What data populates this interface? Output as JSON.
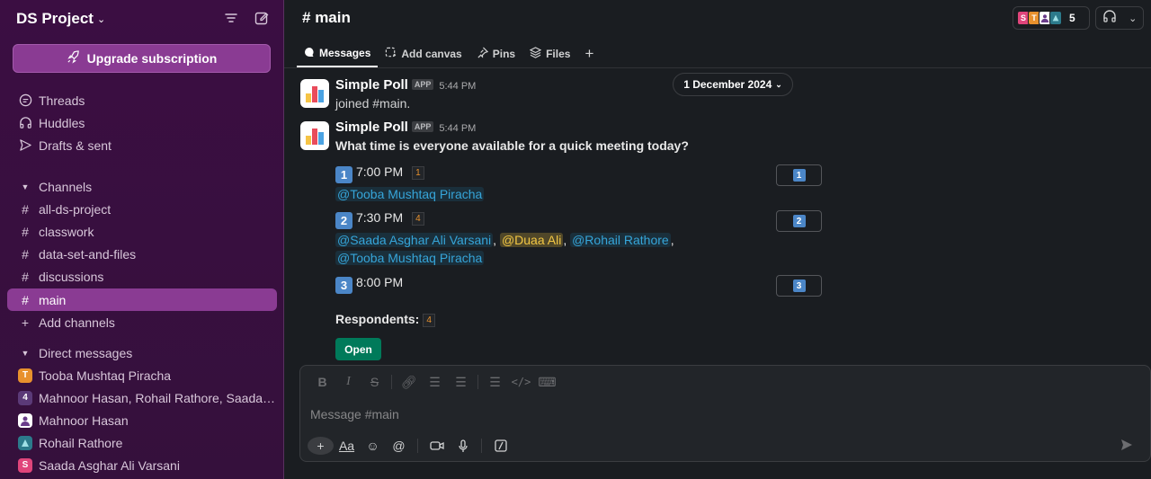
{
  "workspace": {
    "name": "DS Project"
  },
  "upgrade_label": "Upgrade subscription",
  "nav": [
    {
      "label": "Threads",
      "icon": "threads-icon"
    },
    {
      "label": "Huddles",
      "icon": "headphones-icon"
    },
    {
      "label": "Drafts & sent",
      "icon": "send-icon"
    }
  ],
  "channels_section": "Channels",
  "channels": [
    "all-ds-project",
    "classwork",
    "data-set-and-files",
    "discussions",
    "main"
  ],
  "add_channels": "Add channels",
  "dm_section": "Direct messages",
  "dms": [
    {
      "name": "Tooba Mushtaq Piracha",
      "initial": "T",
      "color": "#e8912d"
    },
    {
      "name": "Mahnoor Hasan, Rohail Rathore, Saada…",
      "initial": "4",
      "color": "#5b3a78"
    },
    {
      "name": "Mahnoor Hasan",
      "initial": "",
      "color": "#ffffff"
    },
    {
      "name": "Rohail Rathore",
      "initial": "",
      "color": "#2c7a8b"
    },
    {
      "name": "Saada Asghar Ali Varsani",
      "initial": "S",
      "color": "#e0457b"
    }
  ],
  "channel": {
    "title": "main",
    "member_count": "5"
  },
  "tabs": [
    {
      "label": "Messages",
      "icon": "message-icon"
    },
    {
      "label": "Add canvas",
      "icon": "canvas-icon"
    },
    {
      "label": "Pins",
      "icon": "pin-icon"
    },
    {
      "label": "Files",
      "icon": "files-icon"
    }
  ],
  "date_divider": "1 December 2024",
  "messages": [
    {
      "sender": "Simple Poll",
      "badge": "APP",
      "time": "5:44 PM",
      "text": "joined #main."
    },
    {
      "sender": "Simple Poll",
      "badge": "APP",
      "time": "5:44 PM",
      "text": "What time is everyone available for a quick meeting today?"
    }
  ],
  "poll": {
    "options": [
      {
        "key": "1",
        "time": "7:00 PM",
        "count": "1",
        "voters": [
          "@Tooba Mushtaq Piracha"
        ]
      },
      {
        "key": "2",
        "time": "7:30 PM",
        "count": "4",
        "voters": [
          "@Saada Asghar Ali Varsani",
          "@Duaa Ali",
          "@Rohail Rathore",
          "@Tooba Mushtaq Piracha"
        ]
      },
      {
        "key": "3",
        "time": "8:00 PM",
        "count": "",
        "voters": []
      }
    ],
    "respondents_label": "Respondents:",
    "respondents_count": "4",
    "open_label": "Open"
  },
  "composer": {
    "placeholder": "Message #main"
  },
  "colors": {
    "sidebar": "#3b0e42",
    "accent": "#8a3b93",
    "main_bg": "#1a1d21",
    "mention": "#36a5d9",
    "open_button": "#007a5a"
  }
}
